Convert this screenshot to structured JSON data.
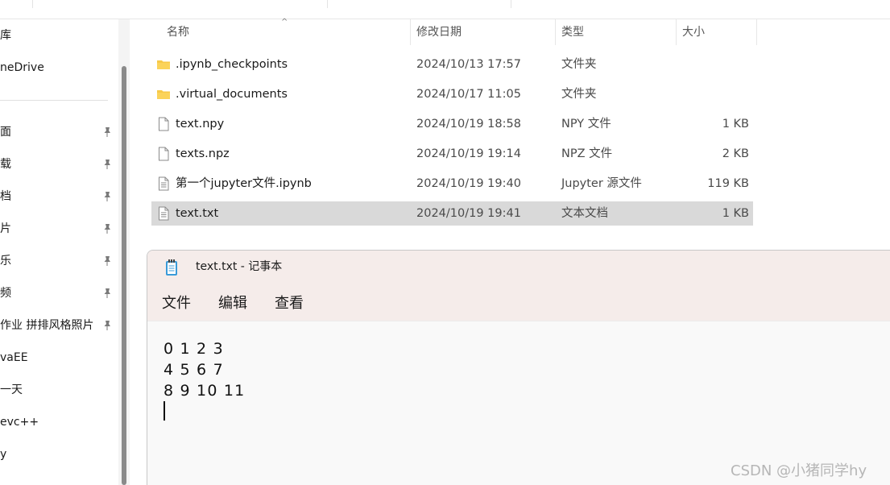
{
  "nav_pane": {
    "items": [
      {
        "label": "库",
        "pinned": false
      },
      {
        "label": "neDrive",
        "pinned": false
      },
      {
        "label": "面",
        "pinned": true
      },
      {
        "label": "载",
        "pinned": true
      },
      {
        "label": "档",
        "pinned": true
      },
      {
        "label": "片",
        "pinned": true
      },
      {
        "label": "乐",
        "pinned": true
      },
      {
        "label": "频",
        "pinned": true
      },
      {
        "label": "作业 拼排风格照片",
        "pinned": true
      },
      {
        "label": "vaEE",
        "pinned": false
      },
      {
        "label": "一天",
        "pinned": false
      },
      {
        "label": "evc++",
        "pinned": false
      },
      {
        "label": "y",
        "pinned": false
      }
    ]
  },
  "file_list": {
    "columns": {
      "name": "名称",
      "modified": "修改日期",
      "type": "类型",
      "size": "大小"
    },
    "sort_indicator": "^",
    "rows": [
      {
        "icon": "folder-icon",
        "name": ".ipynb_checkpoints",
        "modified": "2024/10/13 17:57",
        "type": "文件夹",
        "size": "",
        "selected": false
      },
      {
        "icon": "folder-icon",
        "name": ".virtual_documents",
        "modified": "2024/10/17 11:05",
        "type": "文件夹",
        "size": "",
        "selected": false
      },
      {
        "icon": "blank-file-icon",
        "name": "text.npy",
        "modified": "2024/10/19 18:58",
        "type": "NPY 文件",
        "size": "1 KB",
        "selected": false
      },
      {
        "icon": "blank-file-icon",
        "name": "texts.npz",
        "modified": "2024/10/19 19:14",
        "type": "NPZ 文件",
        "size": "2 KB",
        "selected": false
      },
      {
        "icon": "text-file-icon",
        "name": "第一个jupyter文件.ipynb",
        "modified": "2024/10/19 19:40",
        "type": "Jupyter 源文件",
        "size": "119 KB",
        "selected": false
      },
      {
        "icon": "text-file-icon",
        "name": "text.txt",
        "modified": "2024/10/19 19:41",
        "type": "文本文档",
        "size": "1 KB",
        "selected": true
      }
    ]
  },
  "notepad": {
    "title": "text.txt - 记事本",
    "menu": {
      "file": "文件",
      "edit": "编辑",
      "view": "查看"
    },
    "content_lines": [
      "0 1 2 3",
      "4 5 6 7",
      "8 9 10 11"
    ]
  },
  "watermark": "CSDN @小猪同学hy",
  "colors": {
    "selected_row": "#d9d9d9",
    "notepad_titlebar": "#f5ecea",
    "folder": "#f7c948"
  }
}
